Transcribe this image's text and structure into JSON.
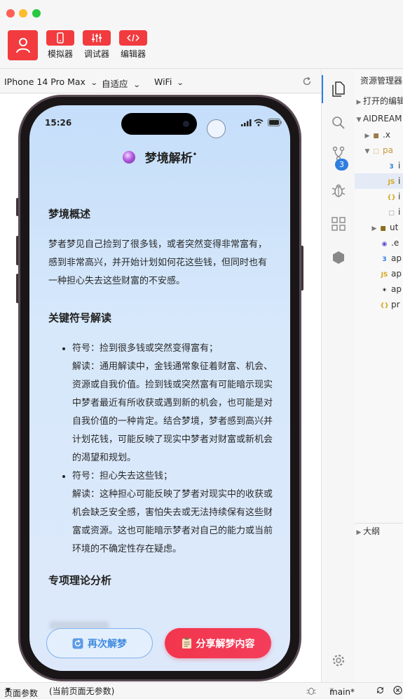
{
  "toolbar": {
    "simulator_label": "模拟器",
    "debugger_label": "调试器",
    "editor_label": "编辑器"
  },
  "device_bar": {
    "device": "IPhone 14 Pro Max",
    "scale": "自适应",
    "network": "WiFi"
  },
  "phone": {
    "time": "15:26",
    "page_title": "梦境解析",
    "sections": {
      "overview_title": "梦境概述",
      "overview_text": "梦者梦见自己捡到了很多钱，或者突然变得非常富有，感到非常高兴，并开始计划如何花这些钱，但同时也有一种担心失去这些财富的不安感。",
      "symbols_title": "关键符号解读",
      "symbol1_label": "符号：捡到很多钱或突然变得富有；",
      "symbol1_text": "解读：通用解读中，金钱通常象征着财富、机会、资源或自我价值。捡到钱或突然富有可能暗示现实中梦者最近有所收获或遇到新的机会，也可能是对自我价值的一种肯定。结合梦境，梦者感到高兴并计划花钱，可能反映了现实中梦者对财富或新机会的渴望和规划。",
      "symbol2_label": "符号：担心失去这些钱；",
      "symbol2_text": "解读：这种担心可能反映了梦者对现实中的收获或机会缺乏安全感，害怕失去或无法持续保有这些财富或资源。这也可能暗示梦者对自己的能力或当前环境的不确定性存在疑虑。",
      "theory_title": "专项理论分析"
    },
    "buttons": {
      "again": "再次解梦",
      "share": "分享解梦内容"
    }
  },
  "activity": {
    "scm_badge": "3"
  },
  "explorer": {
    "title": "资源管理器",
    "open_editors": "打开的编辑器",
    "root": "AIDREAM",
    "rows": [
      ".x",
      "pa",
      "i",
      "i",
      "i",
      "i",
      "ut",
      ".e",
      "ap",
      "ap",
      "ap",
      "pr"
    ],
    "outline": "大纲"
  },
  "status": {
    "page_params": "页面参数",
    "no_params": "(当前页面无参数)",
    "branch": "main*"
  },
  "colors": {
    "brand_red": "#f23b3f",
    "accent_blue": "#2f7ee0"
  }
}
